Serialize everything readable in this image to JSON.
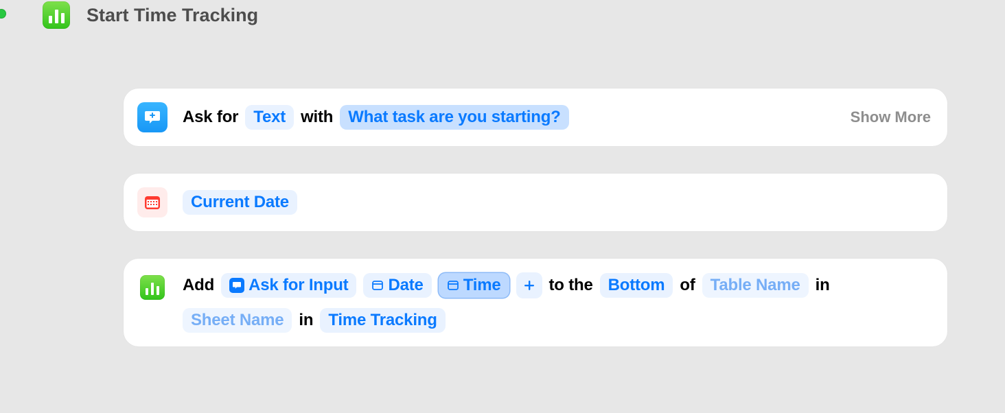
{
  "header": {
    "title": "Start Time Tracking"
  },
  "card1": {
    "ask_for": "Ask for",
    "type_token": "Text",
    "with": "with",
    "prompt": "What task are you starting?",
    "show_more": "Show More"
  },
  "card2": {
    "current_date": "Current Date"
  },
  "card3": {
    "add": "Add",
    "ask_for_input": "Ask for Input",
    "date": "Date",
    "time": "Time",
    "plus": "+",
    "to_the": "to the",
    "bottom": "Bottom",
    "of": "of",
    "table_name": "Table Name",
    "in1": "in",
    "sheet_name": "Sheet Name",
    "in2": "in",
    "document": "Time Tracking"
  }
}
